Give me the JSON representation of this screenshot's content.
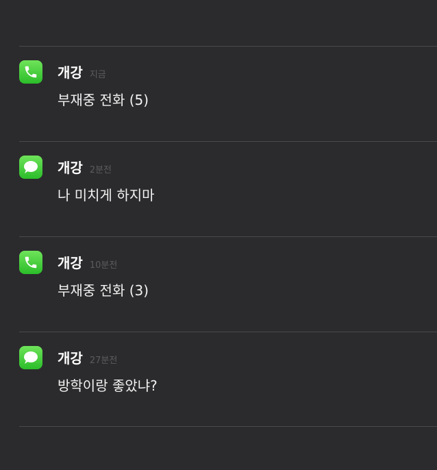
{
  "notifications": [
    {
      "app_icon": "phone-icon",
      "sender": "개강",
      "time": "지금",
      "message": "부재중 전화 (5)"
    },
    {
      "app_icon": "messages-icon",
      "sender": "개강",
      "time": "2분전",
      "message": "나 미치게 하지마"
    },
    {
      "app_icon": "phone-icon",
      "sender": "개강",
      "time": "10분전",
      "message": "부재중 전화 (3)"
    },
    {
      "app_icon": "messages-icon",
      "sender": "개강",
      "time": "27분전",
      "message": "방학이랑 좋았냐?"
    }
  ],
  "colors": {
    "background": "#2b2b2d",
    "divider": "#4a4a4c",
    "icon_green": "#34c133",
    "sender_text": "#ffffff",
    "time_text": "#5c5c5e",
    "message_text": "#f2f2f2"
  }
}
